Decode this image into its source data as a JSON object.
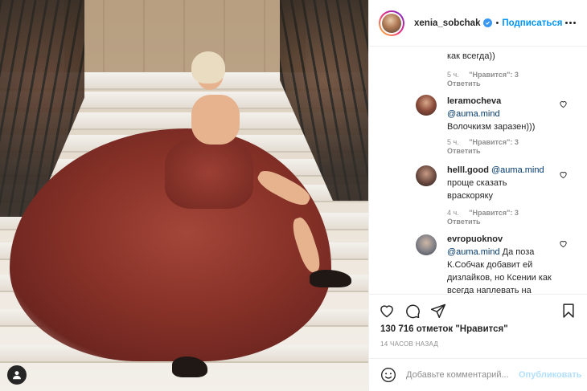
{
  "header": {
    "username": "xenia_sobchak",
    "separator": "•",
    "follow_label": "Подписаться"
  },
  "comments": [
    {
      "text": "как всегда))",
      "time": "5 ч.",
      "likes": "\"Нравится\": 3",
      "reply": "Ответить"
    },
    {
      "username": "leramocheva",
      "mention": "@auma.mind",
      "text": "Волочкизм заразен)))",
      "time": "5 ч.",
      "likes": "\"Нравится\": 3",
      "reply": "Ответить"
    },
    {
      "username": "helll.good",
      "mention": "@auma.mind",
      "text": "проще сказать враскоряку",
      "time": "4 ч.",
      "likes": "\"Нравится\": 3",
      "reply": "Ответить"
    },
    {
      "username": "evropuoknov",
      "mention": "@auma.mind",
      "text": "Да поза К.Собчак добавит ей дизлайков, но Ксении как всегда наплевать на"
    }
  ],
  "stats": {
    "likes_line": "130 716 отметок \"Нравится\"",
    "time_ago": "14 ЧАСОВ НАЗАД"
  },
  "composer": {
    "placeholder": "Добавьте комментарий...",
    "publish_label": "Опубликовать"
  },
  "colors": {
    "accent": "#0095f6",
    "publish_disabled": "#b2dffc",
    "verified": "#3897f0",
    "meta": "#8e8e8e",
    "mention": "#00376b"
  },
  "icons": {
    "photo_user_tag": "user-tag-icon",
    "verified": "verified-badge-icon",
    "more": "more-options-icon",
    "like": "heart-icon",
    "comment": "comment-bubble-icon",
    "share": "paper-plane-icon",
    "save": "bookmark-icon",
    "emoji": "smiley-icon"
  }
}
